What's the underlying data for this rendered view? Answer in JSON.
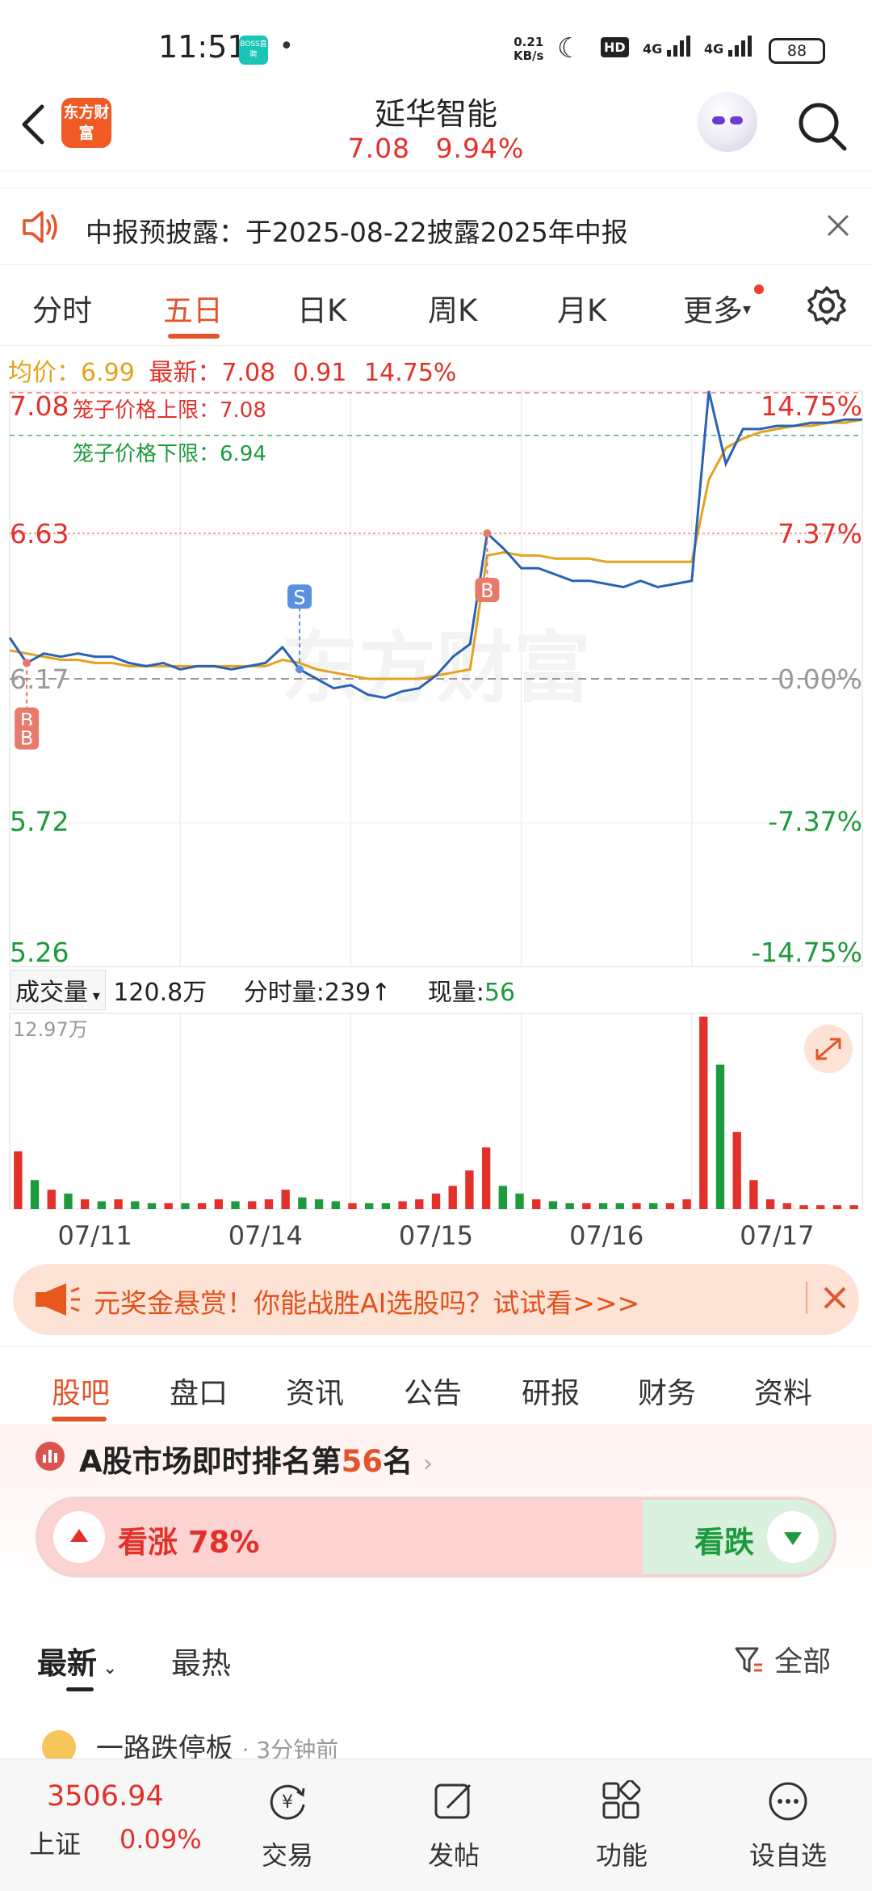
{
  "status_bar": {
    "time": "11:51",
    "boss_badge": "BOSS直聘",
    "net_speed": "0.21",
    "net_unit": "KB/s",
    "hd": "HD",
    "signal1": "4G",
    "signal2": "4G",
    "battery": "88"
  },
  "header": {
    "logo_text": "东方财富",
    "title": "延华智能",
    "price": "7.08",
    "change_pct": "9.94%"
  },
  "notice": {
    "text": "中报预披露：于2025-08-22披露2025年中报"
  },
  "chart_tabs": [
    "分时",
    "五日",
    "日K",
    "周K",
    "月K",
    "更多"
  ],
  "info_line": {
    "avg_label": "均价：",
    "avg_value": "6.99",
    "last_label": "最新：",
    "last_value": "7.08",
    "change": "0.91",
    "change_pct": "14.75%"
  },
  "chart_data": {
    "type": "line",
    "title": "",
    "xlabel": "",
    "ylabel": "",
    "x": [
      "07/11",
      "07/14",
      "07/15",
      "07/16",
      "07/17"
    ],
    "ylim": [
      5.26,
      7.08
    ],
    "y_ticks_left": [
      "7.08",
      "6.63",
      "6.17",
      "5.72",
      "5.26"
    ],
    "y_ticks_right": [
      "14.75%",
      "7.37%",
      "0.00%",
      "-7.37%",
      "-14.75%"
    ],
    "reference_lines": [
      {
        "label": "笼子价格上限：",
        "value": "7.08"
      },
      {
        "label": "笼子价格下限：",
        "value": "6.94"
      }
    ],
    "series": [
      {
        "values": [
          6.3,
          6.22,
          6.25,
          6.24,
          6.25,
          6.24,
          6.24,
          6.22,
          6.21,
          6.22,
          6.2,
          6.21,
          6.21,
          6.2,
          6.21,
          6.22,
          6.27,
          6.2,
          6.17,
          6.14,
          6.15,
          6.12,
          6.11,
          6.13,
          6.14,
          6.18,
          6.24,
          6.28,
          6.63,
          6.58,
          6.52,
          6.52,
          6.5,
          6.48,
          6.48,
          6.47,
          6.46,
          6.48,
          6.46,
          6.47,
          6.48,
          7.08,
          6.85,
          6.96,
          6.96,
          6.97,
          6.97,
          6.98,
          6.98,
          6.99,
          6.99
        ]
      },
      {
        "values": [
          6.26,
          6.25,
          6.24,
          6.23,
          6.23,
          6.22,
          6.22,
          6.21,
          6.21,
          6.21,
          6.21,
          6.21,
          6.21,
          6.21,
          6.21,
          6.21,
          6.23,
          6.22,
          6.2,
          6.19,
          6.18,
          6.17,
          6.17,
          6.17,
          6.17,
          6.18,
          6.19,
          6.2,
          6.56,
          6.57,
          6.56,
          6.56,
          6.55,
          6.55,
          6.55,
          6.54,
          6.54,
          6.54,
          6.54,
          6.54,
          6.54,
          6.8,
          6.9,
          6.93,
          6.95,
          6.96,
          6.97,
          6.97,
          6.98,
          6.98,
          6.99
        ]
      }
    ],
    "markers": [
      {
        "type": "B",
        "x_index": 1
      },
      {
        "type": "B",
        "x_index": 1
      },
      {
        "type": "S",
        "x_index": 17
      },
      {
        "type": "B",
        "x_index": 28
      }
    ],
    "watermark": "东方财富",
    "volume": {
      "label": "成交量",
      "total": "120.8万",
      "tick_label": "分时量:239",
      "now_label": "现量:",
      "now_value": "56",
      "max_label": "12.97万",
      "values": [
        0.3,
        0.15,
        0.1,
        0.08,
        0.05,
        0.04,
        0.05,
        0.04,
        0.03,
        0.03,
        0.03,
        0.03,
        0.05,
        0.04,
        0.04,
        0.05,
        0.1,
        0.06,
        0.05,
        0.04,
        0.03,
        0.03,
        0.03,
        0.04,
        0.05,
        0.08,
        0.12,
        0.2,
        0.32,
        0.12,
        0.08,
        0.05,
        0.04,
        0.03,
        0.03,
        0.03,
        0.03,
        0.03,
        0.03,
        0.03,
        0.05,
        1.0,
        0.75,
        0.4,
        0.15,
        0.05,
        0.03,
        0.02,
        0.02,
        0.02,
        0.02
      ]
    }
  },
  "ad_banner": {
    "text": "元奖金悬赏！你能战胜AI选股吗？试试看>>>"
  },
  "section_tabs": [
    "股吧",
    "盘口",
    "资讯",
    "公告",
    "研报",
    "财务",
    "资料"
  ],
  "ranking": {
    "prefix": "A股市场即时排名第",
    "rank": "56",
    "suffix": "名"
  },
  "sentiment": {
    "bull_label": "看涨 78%",
    "bull_pct": 78,
    "bear_label": "看跌"
  },
  "feed": {
    "latest": "最新",
    "hot": "最热",
    "filter": "全部"
  },
  "post_peek": {
    "author": "一路跌停板",
    "time": "· 3分钟前"
  },
  "bottom_bar": {
    "index_value": "3506.94",
    "index_name": "上证",
    "index_change": "0.09%",
    "buttons": [
      "交易",
      "发帖",
      "功能",
      "设自选"
    ]
  },
  "colors": {
    "accent": "#e2542b",
    "up": "#e2312b",
    "down": "#1d9a3d",
    "avg_line": "#e3a31b",
    "price_line": "#2a62b4"
  }
}
